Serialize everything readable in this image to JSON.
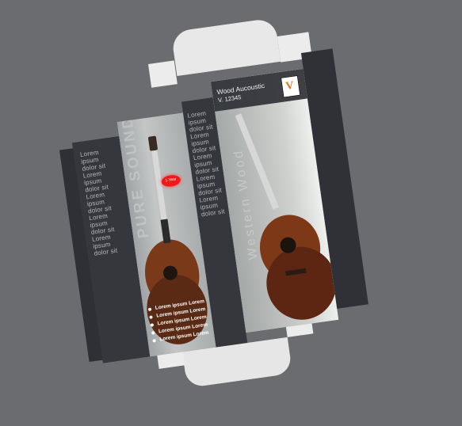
{
  "side_text": "Lorem ipsum dolor sit Lorem ipsum dolor sit Lorem ipsum dolor sit Lorem ipsum dolor sit Lorem ipsum dolor sit",
  "front": {
    "slogan": "PURE SOUND",
    "sticker": "1 Year",
    "bullets": [
      "Lorem ipsum Lorem",
      "Lorem ipsum Lorem",
      "Lorem ipsum Lorem",
      "Lorem ipsum Lorem",
      "Lorem ipsum Lorem"
    ]
  },
  "back": {
    "title": "Wood Aucoustic",
    "model": "V. 12345",
    "vertical_text": "Western Wood",
    "logo_letter": "V"
  }
}
